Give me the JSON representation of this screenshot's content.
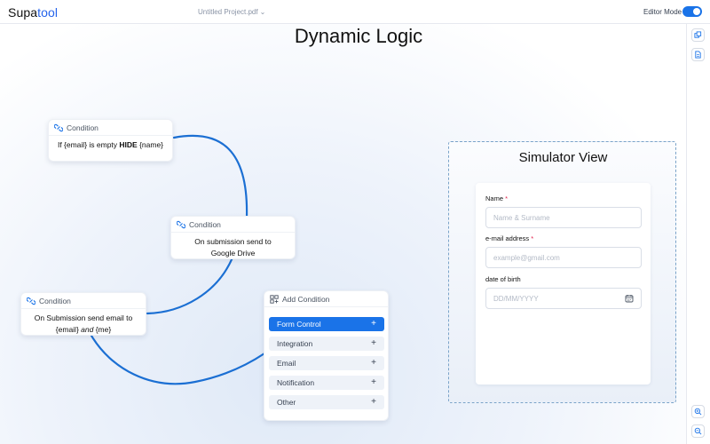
{
  "header": {
    "logo_part1": "Supa",
    "logo_part2": "tool",
    "project_name": "Untitled Project.pdf",
    "editor_mode_label": "Editor Mode",
    "editor_mode_on": true
  },
  "page_title": "Dynamic Logic",
  "colors": {
    "accent": "#1a73e8",
    "wire": "#1b6fd3"
  },
  "nodes": [
    {
      "head": "Condition",
      "line1_a": "If {email} is empty ",
      "line1_b": "HIDE",
      "line1_c": " {name}"
    },
    {
      "head": "Condition",
      "line1": "On submission send to",
      "line2": "Google Drive"
    },
    {
      "head": "Condition",
      "line1": "On Submission send email to",
      "line2_a": "{email} ",
      "line2_b": "and",
      "line2_c": " {me}"
    }
  ],
  "add_condition": {
    "title": "Add Condition",
    "items": [
      {
        "label": "Form Control",
        "active": true
      },
      {
        "label": "Integration",
        "active": false
      },
      {
        "label": "Email",
        "active": false
      },
      {
        "label": "Notification",
        "active": false
      },
      {
        "label": "Other",
        "active": false
      }
    ],
    "plus": "+"
  },
  "simulator": {
    "title": "Simulator View",
    "fields": [
      {
        "label": "Name",
        "required": true,
        "placeholder": "Name & Surname"
      },
      {
        "label": "e-mail address",
        "required": true,
        "placeholder": "example@gmail.com"
      },
      {
        "label": "date of birth",
        "required": false,
        "placeholder": "DD/MM/YYYY"
      }
    ],
    "required_mark": "*"
  },
  "icons": {
    "link": "link-icon",
    "grid": "grid-add-icon",
    "calendar": "calendar-icon",
    "layers": "layers-icon",
    "document": "document-icon",
    "zoom_in": "zoom-in-icon",
    "zoom_out": "zoom-out-icon"
  }
}
